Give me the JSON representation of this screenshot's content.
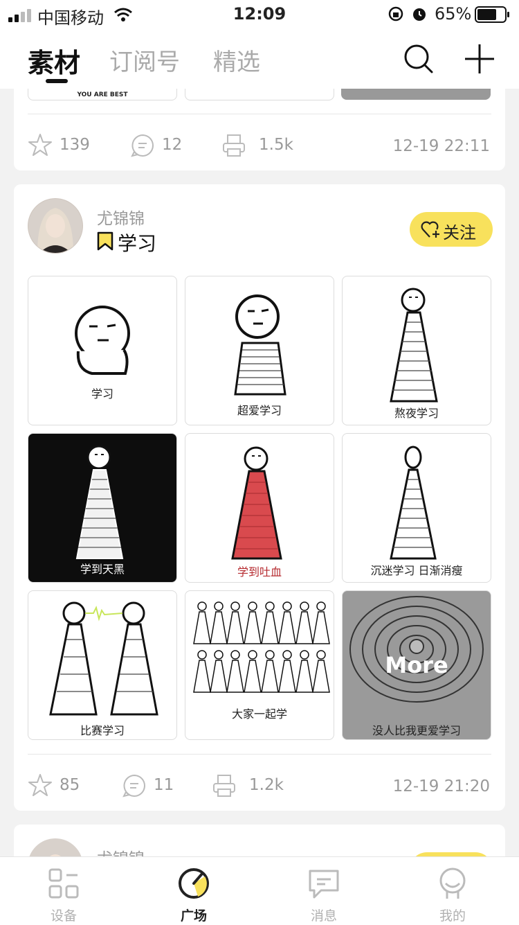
{
  "status_bar": {
    "carrier": "中国移动",
    "time": "12:09",
    "battery": "65%"
  },
  "header": {
    "tabs": [
      {
        "label": "素材",
        "active": true
      },
      {
        "label": "订阅号",
        "active": false
      },
      {
        "label": "精选",
        "active": false
      }
    ]
  },
  "post_prev": {
    "partial_caption": "YOU ARE BEST",
    "likes": "139",
    "comments": "12",
    "prints": "1.5k",
    "timestamp": "12-19 22:11"
  },
  "post": {
    "username": "尤锦锦",
    "tag": "学习",
    "follow_label": "关注",
    "images": [
      {
        "caption": "学习",
        "style": "light"
      },
      {
        "caption": "超爱学习",
        "style": "light"
      },
      {
        "caption": "熬夜学习",
        "style": "light"
      },
      {
        "caption": "学到天黑",
        "style": "dark"
      },
      {
        "caption": "学到吐血",
        "style": "red"
      },
      {
        "caption": "沉迷学习 日渐消瘦",
        "style": "light"
      },
      {
        "caption": "比赛学习",
        "style": "light"
      },
      {
        "caption": "大家一起学",
        "style": "light"
      },
      {
        "caption": "没人比我更爱学习",
        "style": "more"
      }
    ],
    "more_label": "More",
    "likes": "85",
    "comments": "11",
    "prints": "1.2k",
    "timestamp": "12-19 21:20"
  },
  "post_next": {
    "username": "尤锦锦"
  },
  "bottom_nav": [
    {
      "label": "设备",
      "icon": "device-icon",
      "active": false
    },
    {
      "label": "广场",
      "icon": "plaza-icon",
      "active": true
    },
    {
      "label": "消息",
      "icon": "message-icon",
      "active": false
    },
    {
      "label": "我的",
      "icon": "profile-icon",
      "active": false
    }
  ],
  "colors": {
    "accent": "#f8e15c",
    "text": "#222222",
    "muted": "#999999",
    "background": "#f2f2f2"
  }
}
